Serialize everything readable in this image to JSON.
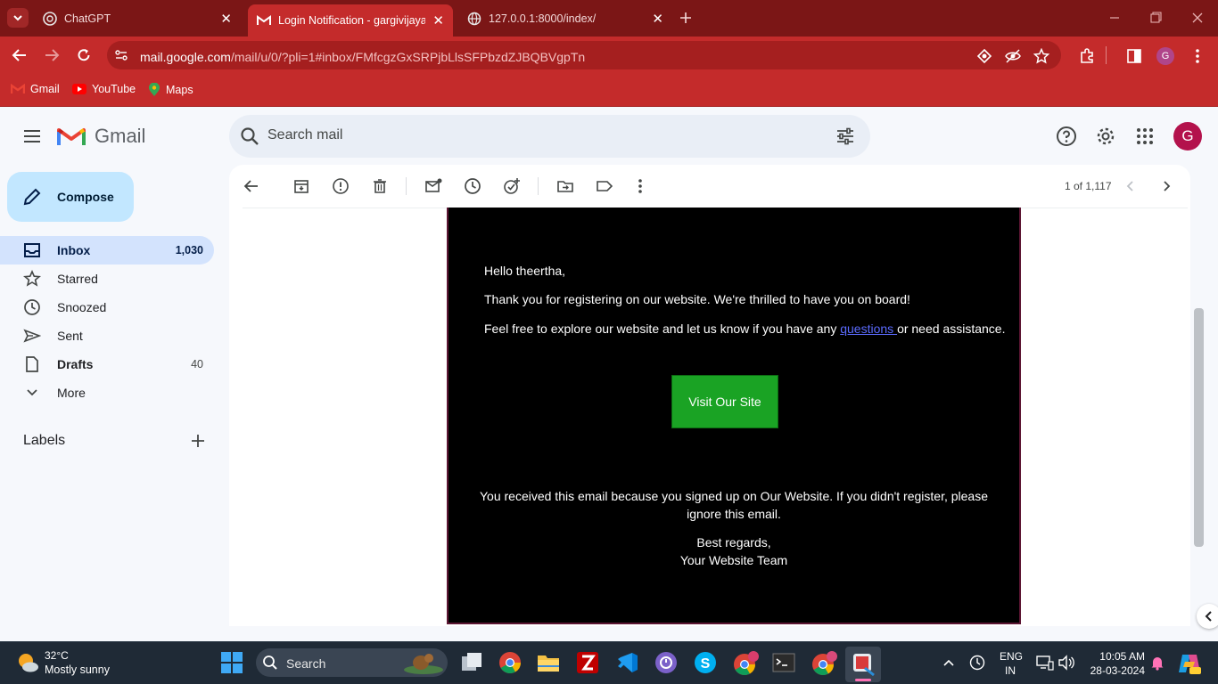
{
  "browser": {
    "tabs": [
      {
        "label": "ChatGPT",
        "active": false
      },
      {
        "label": "Login Notification - gargivijayan",
        "active": true
      },
      {
        "label": "127.0.0.1:8000/index/",
        "active": false
      }
    ],
    "url_host": "mail.google.com",
    "url_path": "/mail/u/0/?pli=1#inbox/FMfcgzGxSRPjbLlsSFPbzdZJBQBVgpTn",
    "profile_initial": "G",
    "bookmarks": [
      "Gmail",
      "YouTube",
      "Maps"
    ],
    "accent": "#c42b2b"
  },
  "gmail": {
    "app_name": "Gmail",
    "search_placeholder": "Search mail",
    "account_initial": "G",
    "compose_label": "Compose",
    "nav": [
      {
        "label": "Inbox",
        "count": "1,030",
        "active": true
      },
      {
        "label": "Starred",
        "count": ""
      },
      {
        "label": "Snoozed",
        "count": ""
      },
      {
        "label": "Sent",
        "count": ""
      },
      {
        "label": "Drafts",
        "count": "40"
      },
      {
        "label": "More",
        "count": ""
      }
    ],
    "labels_heading": "Labels",
    "pager": "1 of 1,117"
  },
  "email": {
    "greeting": "Hello theertha,",
    "line1": "Thank you for registering on our website. We're thrilled to have you on board!",
    "line2_before": "Feel free to explore our website and let us know if you have any ",
    "line2_link": "questions ",
    "line2_after": "or need assistance.",
    "button": "Visit Our Site",
    "footer1": "You received this email because you signed up on Our Website. If you didn't register, please",
    "footer2": "ignore this email.",
    "regards": "Best regards,",
    "team": "Your Website Team",
    "button_color": "#1aa324",
    "background": "#000000"
  },
  "taskbar": {
    "temperature": "32°C",
    "weather": "Mostly sunny",
    "search_label": "Search",
    "lang1": "ENG",
    "lang2": "IN",
    "time": "10:05 AM",
    "date": "28-03-2024"
  }
}
